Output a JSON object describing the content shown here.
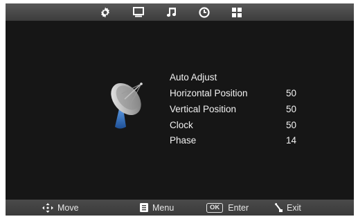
{
  "tabs": [
    {
      "icon": "gear-icon"
    },
    {
      "icon": "monitor-icon"
    },
    {
      "icon": "music-note-icon"
    },
    {
      "icon": "clock-icon"
    },
    {
      "icon": "grid-icon"
    }
  ],
  "menu": {
    "items": [
      {
        "label": "Auto Adjust",
        "value": ""
      },
      {
        "label": "Horizontal Position",
        "value": "50"
      },
      {
        "label": "Vertical Position",
        "value": "50"
      },
      {
        "label": "Clock",
        "value": "50"
      },
      {
        "label": "Phase",
        "value": "14"
      }
    ]
  },
  "footer": {
    "move": {
      "label": "Move",
      "icon": "move-arrows-icon"
    },
    "menu": {
      "label": "Menu",
      "icon": "menu-icon"
    },
    "enter": {
      "label": "Enter",
      "key": "OK",
      "icon": "ok-key-icon"
    },
    "exit": {
      "label": "Exit",
      "icon": "exit-icon"
    }
  },
  "colors": {
    "background": "#161616",
    "bar": "#4a4a4a",
    "text": "#f2f2f2",
    "dish_base": "#2f6fc0"
  }
}
